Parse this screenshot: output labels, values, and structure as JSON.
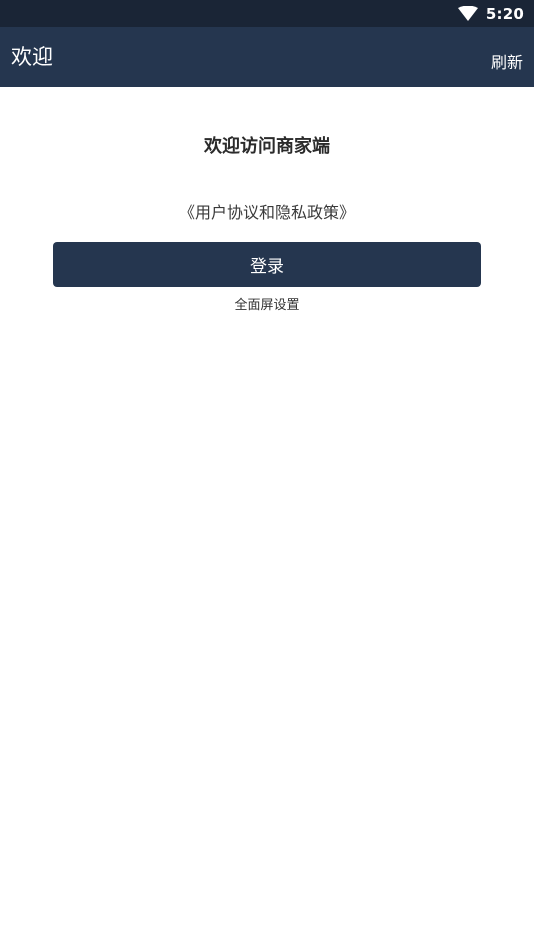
{
  "status_bar": {
    "time": "5:20",
    "icons": [
      "wifi-icon"
    ]
  },
  "app_bar": {
    "title": "欢迎",
    "refresh_label": "刷新"
  },
  "main": {
    "heading": "欢迎访问商家端",
    "policy_link": "《用户协议和隐私政策》",
    "login_label": "登录",
    "fullscreen_label": "全面屏设置"
  },
  "colors": {
    "status_bar": "#1a2536",
    "app_bar": "#25364f",
    "button": "#25364f",
    "background": "#ffffff"
  }
}
